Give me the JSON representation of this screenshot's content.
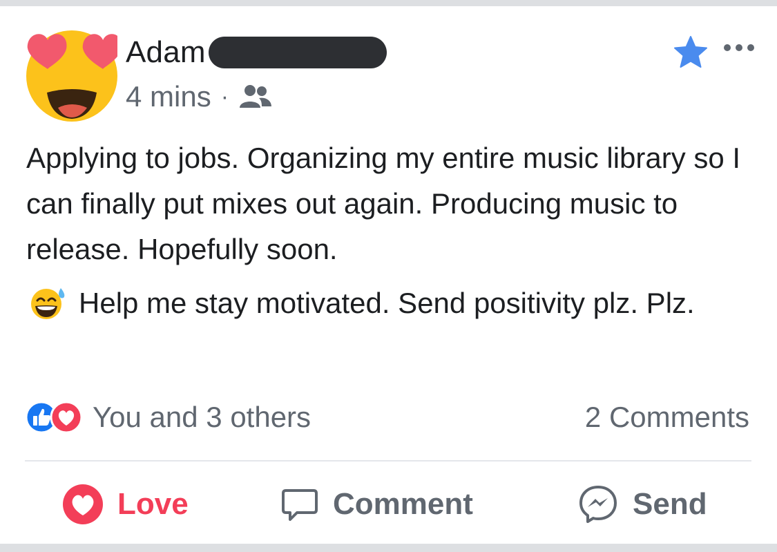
{
  "post": {
    "author_name": "Adam",
    "timestamp": "4 mins",
    "separator": "·",
    "audience_icon": "friends-icon",
    "body_line1": "Applying to jobs. Organizing my entire music library so I can finally put mixes out again. Producing music to release. Hopefully soon.",
    "body_line2": "Help me stay motivated. Send positivity plz.   Plz."
  },
  "reactions": {
    "summary": "You and 3 others",
    "comments": "2 Comments"
  },
  "actions": {
    "love": "Love",
    "comment": "Comment",
    "send": "Send"
  },
  "colors": {
    "love_red": "#f33e58",
    "like_blue": "#1877f2",
    "star_blue": "#4a8bee",
    "secondary_text": "#606770"
  }
}
